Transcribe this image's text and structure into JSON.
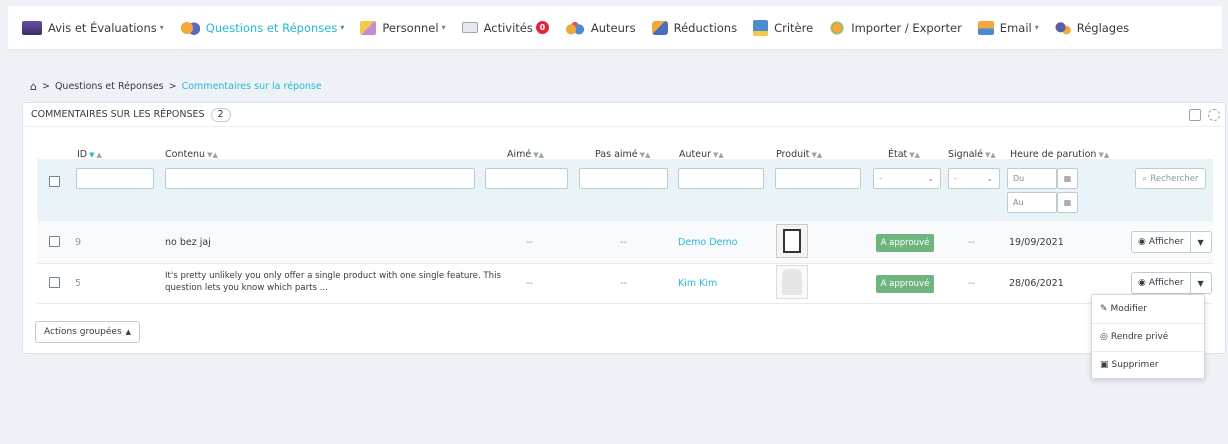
{
  "nav": [
    {
      "label": "Avis et Évaluations",
      "icon": "reviews-icon",
      "caret": true,
      "active": false
    },
    {
      "label": "Questions et Réponses",
      "icon": "qa-icon",
      "caret": true,
      "active": true
    },
    {
      "label": "Personnel",
      "icon": "staff-icon",
      "caret": true,
      "active": false
    },
    {
      "label": "Activités",
      "icon": "activity-icon",
      "badge": "0",
      "active": false
    },
    {
      "label": "Auteurs",
      "icon": "authors-icon",
      "active": false
    },
    {
      "label": "Réductions",
      "icon": "discount-icon",
      "active": false
    },
    {
      "label": "Critère",
      "icon": "criteria-icon",
      "active": false
    },
    {
      "label": "Importer / Exporter",
      "icon": "import-export-icon",
      "active": false
    },
    {
      "label": "Email",
      "icon": "email-icon",
      "caret": true,
      "active": false
    },
    {
      "label": "Réglages",
      "icon": "settings-icon",
      "active": false
    }
  ],
  "breadcrumb": {
    "home": "⌂",
    "sep": ">",
    "parent": "Questions et Réponses",
    "current": "Commentaires sur la réponse"
  },
  "panel": {
    "title": "Commentaires sur les réponses",
    "count": "2"
  },
  "columns": {
    "id": "ID",
    "content": "Contenu",
    "liked": "Aimé",
    "disliked": "Pas aimé",
    "author": "Auteur",
    "product": "Produit",
    "state": "État",
    "reported": "Signalé",
    "time": "Heure de parution"
  },
  "filters": {
    "state_value": "-",
    "reported_value": "-",
    "date_from_placeholder": "Du",
    "date_to_placeholder": "Au",
    "search_label": "Rechercher"
  },
  "rows": [
    {
      "id": "9",
      "content": "no bez jaj",
      "liked": "--",
      "disliked": "--",
      "author": "Demo Demo",
      "state": "A approuvé",
      "reported": "--",
      "date": "19/09/2021",
      "action": "Afficher"
    },
    {
      "id": "5",
      "content_line1": "It's pretty unlikely you only offer a single product with one single feature. This",
      "content_line2": "question lets you know which parts ...",
      "liked": "--",
      "disliked": "--",
      "author": "Kim Kim",
      "state": "A approuvé",
      "reported": "--",
      "date": "28/06/2021",
      "action": "Afficher"
    }
  ],
  "bulk_label": "Actions groupées",
  "menu": {
    "edit": "Modifier",
    "private": "Rendre privé",
    "delete": "Supprimer"
  },
  "colors": {
    "accent": "#25b9d7",
    "success": "#70b580",
    "danger": "#e3243b"
  }
}
